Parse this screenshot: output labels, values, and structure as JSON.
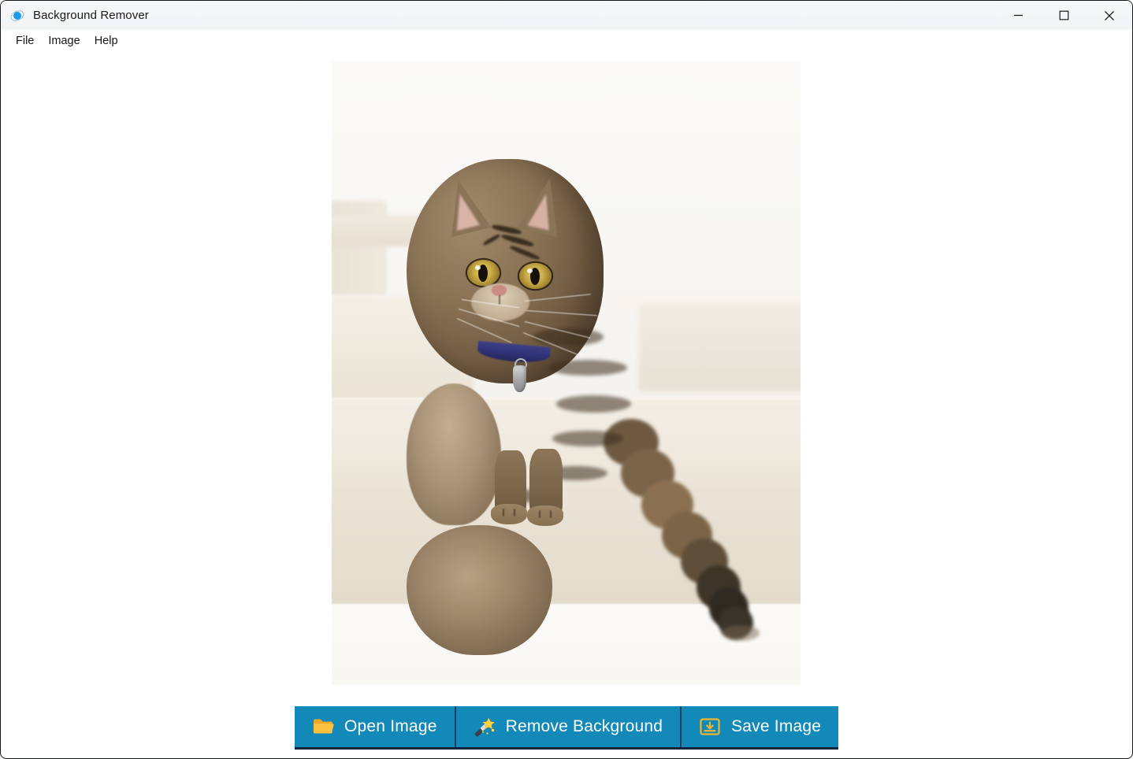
{
  "window": {
    "title": "Background Remover",
    "icon": "app-sparkle-icon",
    "controls": [
      {
        "name": "minimize",
        "glyph": "minimize-icon"
      },
      {
        "name": "maximize",
        "glyph": "maximize-icon"
      },
      {
        "name": "close",
        "glyph": "close-icon"
      }
    ]
  },
  "menu": {
    "items": [
      {
        "label": "File"
      },
      {
        "label": "Image"
      },
      {
        "label": "Help"
      }
    ]
  },
  "canvas": {
    "background_color": "#ffffff",
    "image": {
      "alt": "Tabby cat with blue collar and silver tag sitting on cream carpeted stairs",
      "subject": "cat",
      "background_removed": false
    }
  },
  "toolbar": {
    "buttons": [
      {
        "label": "Open Image",
        "icon": "folder-open-icon"
      },
      {
        "label": "Remove Background",
        "icon": "magic-wand-icon"
      },
      {
        "label": "Save Image",
        "icon": "save-download-icon"
      }
    ],
    "accent_color": "#1289b8",
    "icon_color": "#f5b731",
    "label_color": "#ffffff"
  }
}
